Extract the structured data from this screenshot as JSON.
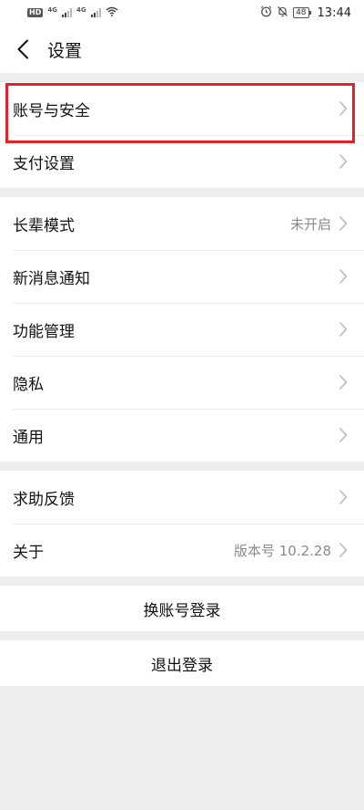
{
  "status_bar": {
    "hd": "HD",
    "net1": "4G",
    "net2": "4G",
    "battery": "48",
    "time": "13:44"
  },
  "nav": {
    "title": "设置"
  },
  "groups": [
    [
      {
        "label": "账号与安全",
        "value": ""
      },
      {
        "label": "支付设置",
        "value": ""
      }
    ],
    [
      {
        "label": "长辈模式",
        "value": "未开启"
      },
      {
        "label": "新消息通知",
        "value": ""
      },
      {
        "label": "功能管理",
        "value": ""
      },
      {
        "label": "隐私",
        "value": ""
      },
      {
        "label": "通用",
        "value": ""
      }
    ],
    [
      {
        "label": "求助反馈",
        "value": ""
      },
      {
        "label": "关于",
        "value": "版本号 10.2.28"
      }
    ]
  ],
  "actions": {
    "switch_account": "换账号登录",
    "logout": "退出登录"
  },
  "colors": {
    "highlight": "#e0222a",
    "background": "#ededed"
  }
}
